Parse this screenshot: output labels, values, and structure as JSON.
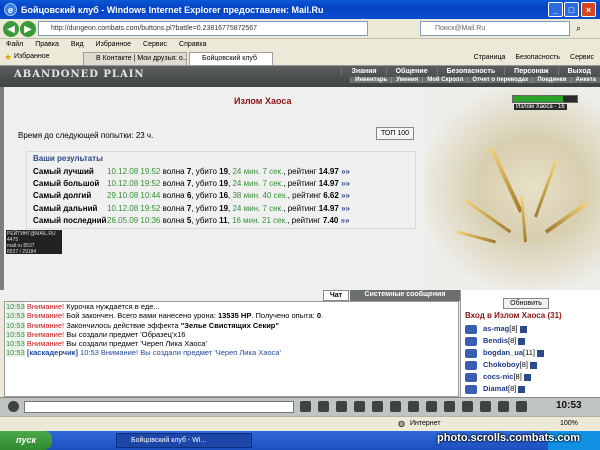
{
  "window": {
    "title": "Бойцовский клуб - Windows Internet Explorer предоставлен: Mail.Ru"
  },
  "browser": {
    "address": "http://dungeon.combats.com/buttons.pl?battle=0.23816775872567",
    "search_placeholder": "Поиск@Mail.Ru",
    "menu": [
      "Файл",
      "Правка",
      "Вид",
      "Избранное",
      "Сервис",
      "Справка"
    ],
    "favorites_label": "Избранное",
    "tabs": [
      "В Контакте | Мои друзья: о...",
      "Бойцовский клуб"
    ],
    "tab_tools": [
      "Страница",
      "Безопасность",
      "Сервис"
    ]
  },
  "game": {
    "logo": "ABANDONED PLAIN",
    "nav_top": [
      "Знания",
      "Общение",
      "Безопасность",
      "Персонаж",
      "Выход"
    ],
    "nav_sub": [
      "Инвентарь",
      "Умения",
      "Мой Скролл",
      "Отчет о переводах",
      "Поединки",
      "Анкета"
    ],
    "location_label": "Излом Хаоса - 16",
    "hp_fraction": 0.78,
    "page_title": "Излом Хаоса",
    "next_try": "Время до следующей попытки: 23 ч.",
    "top100_label": "ТОП 100",
    "results_title": "Ваши результаты",
    "results": [
      {
        "name": "Самый лучший",
        "date": "10.12.08 19:52",
        "wave": "7",
        "killed": "19",
        "time": "24 мин. 7 сек.",
        "rating": "14.97"
      },
      {
        "name": "Самый большой",
        "date": "10.12.08 19:52",
        "wave": "7",
        "killed": "19",
        "time": "24 мин. 7 сек.",
        "rating": "14.97"
      },
      {
        "name": "Самый долгий",
        "date": "29.10.08 10:44",
        "wave": "6",
        "killed": "16",
        "time": "38 мин. 40 сек.",
        "rating": "6.62"
      },
      {
        "name": "Самый дальний",
        "date": "10.12.08 19:52",
        "wave": "7",
        "killed": "19",
        "time": "24 мин. 7 сек.",
        "rating": "14.97"
      },
      {
        "name": "Самый последний",
        "date": "26.05.09 10:36",
        "wave": "5",
        "killed": "11",
        "time": "16 мин. 21 сек.",
        "rating": "7.40"
      }
    ],
    "wave_word": "волна",
    "killed_word": ", убито",
    "rating_word": ", рейтинг",
    "arrow": "»»",
    "stamp": [
      "РЕЙТИНГ@MAIL.RU 4475",
      "mail.ru 8537",
      "8537 / 29184"
    ]
  },
  "chat": {
    "tab_chat": "Чат",
    "tab_system": "Системные сообщения",
    "lines": [
      {
        "time": "10:53",
        "warn": "Внимание!",
        "text": "Курочка нуждается в еде..."
      },
      {
        "time": "10:53",
        "warn": "Внимание!",
        "text": "Бой закончен. Всего вами нанесено урона:",
        "b1": "13535 HP",
        "text2": ". Получено опыта:",
        "b2": "0",
        "text3": "."
      },
      {
        "time": "10:53",
        "warn": "Внимание!",
        "text": "Закончилось действие эффекта",
        "b1": "\"Зелье Свистящих Секир\""
      },
      {
        "time": "10:53",
        "warn": "Внимание!",
        "text": "Вы создали предмет 'Образец'x16"
      },
      {
        "time": "10:53",
        "warn": "Внимание!",
        "text": "Вы создали предмет 'Череп Лика Хаоса'"
      }
    ],
    "last_line": {
      "time": "10:53",
      "user": "[каскадерчик]",
      "text": "10:53 Внимание! Вы создали предмет 'Череп Лика Хаоса'"
    }
  },
  "online": {
    "refresh_label": "Обновить",
    "title": "Вход в Излом Хаоса (31)",
    "users": [
      {
        "name": "as-mag",
        "level": "[8]"
      },
      {
        "name": "Bendis",
        "level": "[8]"
      },
      {
        "name": "bogdan_ua",
        "level": "[11]"
      },
      {
        "name": "Chokoboy",
        "level": "[8]"
      },
      {
        "name": "cocs-nic",
        "level": "[8]"
      },
      {
        "name": "Diamat",
        "level": "[8]"
      }
    ]
  },
  "status": {
    "zone": "Интернет",
    "zoom": "100%"
  },
  "taskbar": {
    "start": "пуск",
    "item": "Бойцовский клуб - Wi...",
    "clock": "10:53"
  },
  "watermark": "photo.scrolls.combats.com"
}
